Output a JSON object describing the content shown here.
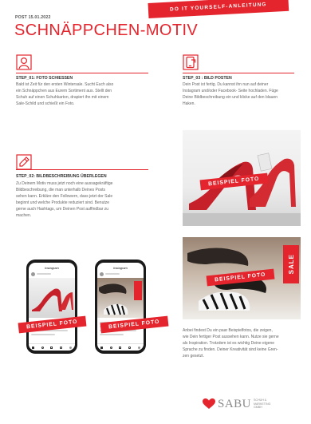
{
  "header": {
    "post_date": "POST 15.01.2022",
    "banner": "DO IT YOURSELF-ANLEITUNG",
    "title": "SCHNÄPPCHEN-MOTIV"
  },
  "steps": [
    {
      "icon": "person-icon",
      "heading": "STEP_01: FOTO SCHIESSEN",
      "lines": [
        "Bald ist Zeit für den ersten Wintersale. Sucht Euch also",
        "ein Schnäppchen aus Eurem Sortiment aus. Stellt den",
        "Schuh auf einen Schuhkarton, drapiert ihn mit einem",
        "Sale-Schild und schießt ein Foto."
      ]
    },
    {
      "icon": "pencil-edit-icon",
      "heading": "STEP_02: BILDBESCHREIBUNG ÜBERLEGEN",
      "lines": [
        "Zu Deinem Motiv muss jetzt noch eine aussagekräftige",
        "Bildbeschreibung, die man unterhalb Deines Posts",
        "sehen kann. Erkläre den Followern, dass jetzt der Sale",
        "beginnt und welche Produkte reduziert sind. Benutze",
        "gerne auch Hashtags, um Deinen Post auffindbar zu",
        "machen."
      ]
    },
    {
      "icon": "phone-post-icon",
      "heading": "STEP_03 : BILD POSTEN",
      "lines": [
        "Dein Post ist fertig. Du kannst ihn nun auf deiner",
        "Instagram und/oder Facebook- Seite hochladen. Füge",
        "Deine Bildbeschreibung ein und klicke auf den blauen",
        "Haken."
      ]
    }
  ],
  "photo_label": "BEISPIEL FOTO",
  "sale_tag": "SALE",
  "phone_app_title": "Instagram",
  "footer": {
    "lines": [
      "Anbei findest Du ein paar Beispielfotos, die zeigen,",
      "wie Dein fertiger Post aussehen kann. Nutze sie gerne",
      "als Inspiration. Trotzdem ist es wichtig Deine eigene",
      "Sprache zu finden. Deiner Kreativität sind keine Gren-",
      "zen gesetzt."
    ]
  },
  "logo": {
    "word": "SABU",
    "sub": [
      "SCHUH &",
      "MARKETING",
      "GMBH"
    ]
  },
  "colors": {
    "accent": "#e4252d",
    "text": "#666666",
    "heading": "#333333"
  }
}
